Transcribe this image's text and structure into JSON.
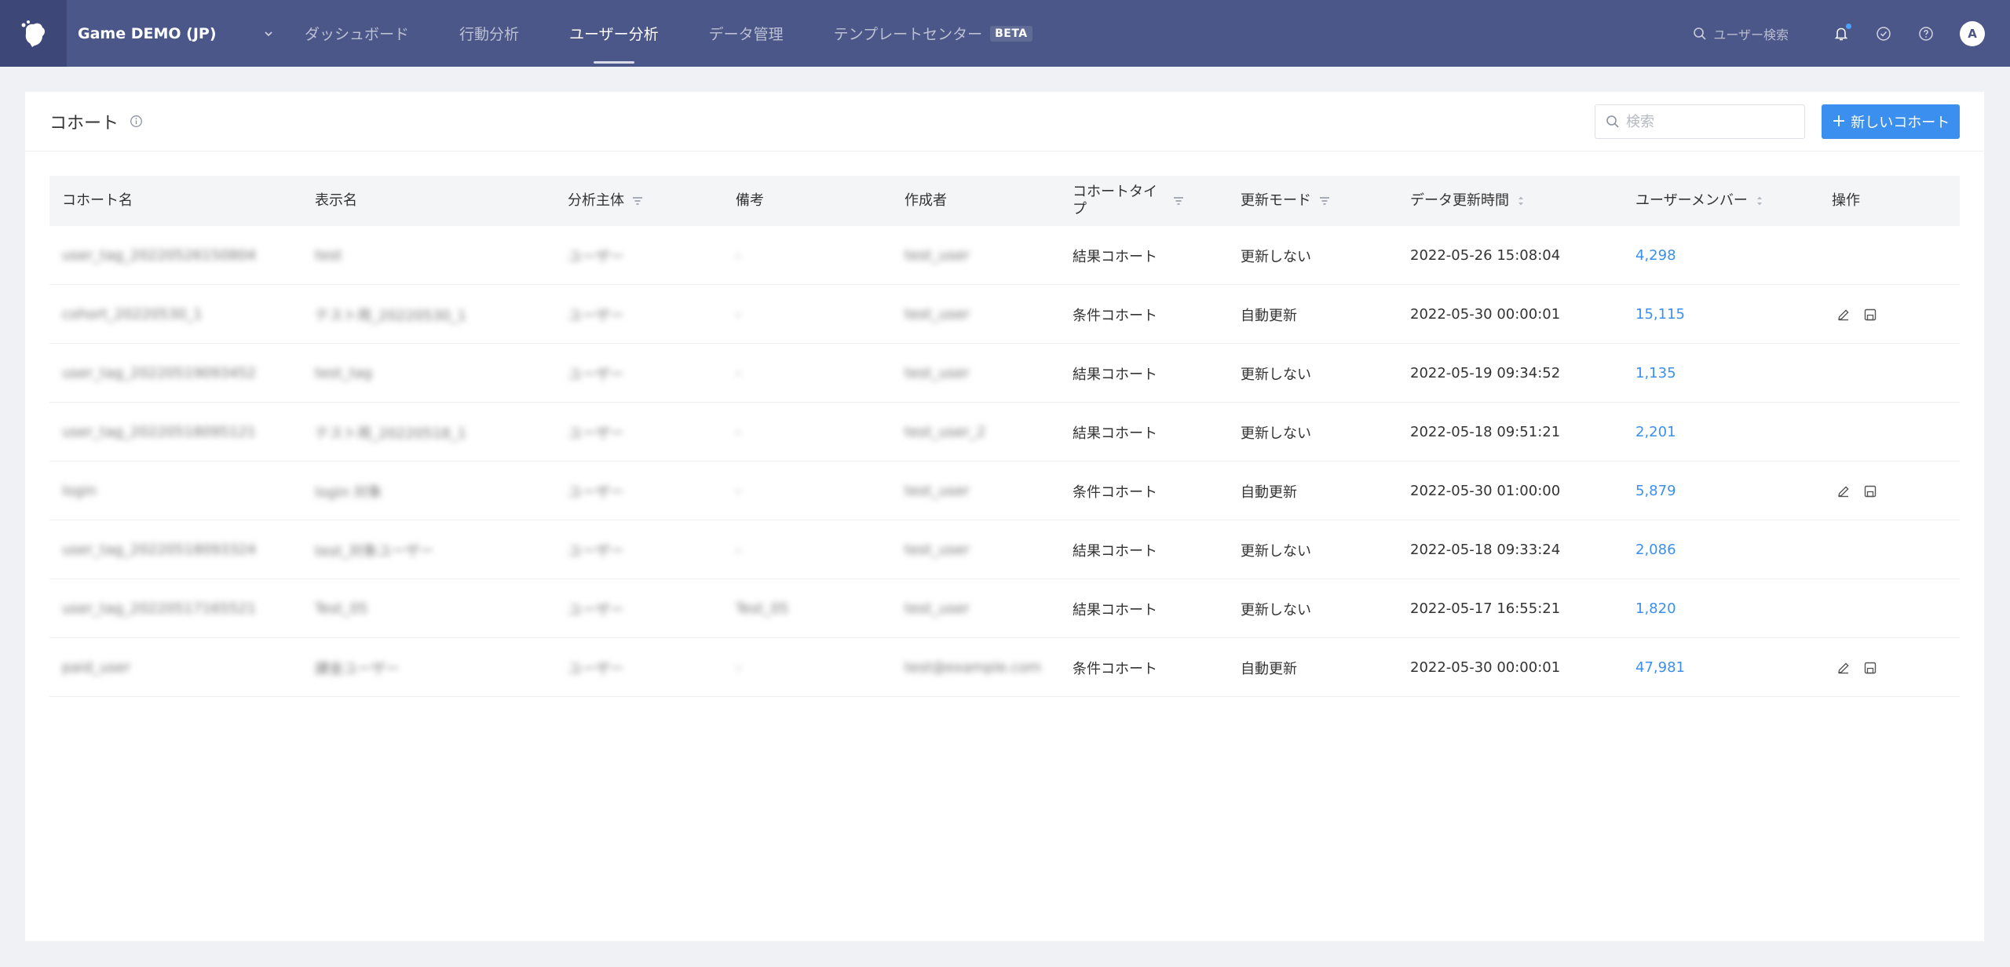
{
  "nav": {
    "project_name": "Game DEMO (JP)",
    "tabs": [
      {
        "label": "ダッシュボード"
      },
      {
        "label": "行動分析"
      },
      {
        "label": "ユーザー分析"
      },
      {
        "label": "データ管理"
      },
      {
        "label": "テンプレートセンター"
      }
    ],
    "active_tab": "ユーザー分析",
    "beta_badge": "BETA",
    "user_search": "ユーザー検索",
    "avatar_letter": "A",
    "notification_dot_color": "#4aa3ff"
  },
  "page": {
    "title": "コホート",
    "search_placeholder": "検索",
    "new_button": "新しいコホート"
  },
  "table": {
    "headers": {
      "cohort_name": "コホート名",
      "display_name": "表示名",
      "subject": "分析主体",
      "note": "備考",
      "creator": "作成者",
      "cohort_type": "コホートタイプ",
      "update_mode": "更新モード",
      "data_update_time": "データ更新時間",
      "user_members": "ユーザーメンバー",
      "actions": "操作"
    },
    "rows": [
      {
        "name": "user_tag_20220526150804",
        "display": "test",
        "subject": "ユーザー",
        "note": "-",
        "creator": "test_user",
        "type": "結果コホート",
        "mode": "更新しない",
        "time": "2022-05-26 15:08:04",
        "members": "4,298",
        "editable": false
      },
      {
        "name": "cohort_20220530_1",
        "display": "テスト用_20220530_1",
        "subject": "ユーザー",
        "note": "-",
        "creator": "test_user",
        "type": "条件コホート",
        "mode": "自動更新",
        "time": "2022-05-30 00:00:01",
        "members": "15,115",
        "editable": true
      },
      {
        "name": "user_tag_20220519093452",
        "display": "test_tag",
        "subject": "ユーザー",
        "note": "-",
        "creator": "test_user",
        "type": "結果コホート",
        "mode": "更新しない",
        "time": "2022-05-19 09:34:52",
        "members": "1,135",
        "editable": false
      },
      {
        "name": "user_tag_20220518095121",
        "display": "テスト用_20220518_1",
        "subject": "ユーザー",
        "note": "-",
        "creator": "test_user_2",
        "type": "結果コホート",
        "mode": "更新しない",
        "time": "2022-05-18 09:51:21",
        "members": "2,201",
        "editable": false
      },
      {
        "name": "login",
        "display": "login 対象",
        "subject": "ユーザー",
        "note": "-",
        "creator": "test_user",
        "type": "条件コホート",
        "mode": "自動更新",
        "time": "2022-05-30 01:00:00",
        "members": "5,879",
        "editable": true
      },
      {
        "name": "user_tag_20220518093324",
        "display": "test_対象ユーザー",
        "subject": "ユーザー",
        "note": "-",
        "creator": "test_user",
        "type": "結果コホート",
        "mode": "更新しない",
        "time": "2022-05-18 09:33:24",
        "members": "2,086",
        "editable": false
      },
      {
        "name": "user_tag_20220517165521",
        "display": "Test_05",
        "subject": "ユーザー",
        "note": "Test_05",
        "creator": "test_user",
        "type": "結果コホート",
        "mode": "更新しない",
        "time": "2022-05-17 16:55:21",
        "members": "1,820",
        "editable": false
      },
      {
        "name": "paid_user",
        "display": "課金ユーザー",
        "subject": "ユーザー",
        "note": "-",
        "creator": "test@example.com",
        "type": "条件コホート",
        "mode": "自動更新",
        "time": "2022-05-30 00:00:01",
        "members": "47,981",
        "editable": true
      }
    ]
  },
  "icons": {
    "logo": "hand-logo-icon",
    "dropdown": "chevron-down-icon",
    "search": "search-icon",
    "bell": "bell-icon",
    "check": "check-circle-icon",
    "help": "help-circle-icon",
    "info": "info-icon",
    "filter": "filter-icon",
    "sort": "sort-icon",
    "edit": "edit-icon",
    "save": "save-icon"
  },
  "colors": {
    "nav_bg": "#4b5788",
    "primary": "#3b8fee"
  }
}
